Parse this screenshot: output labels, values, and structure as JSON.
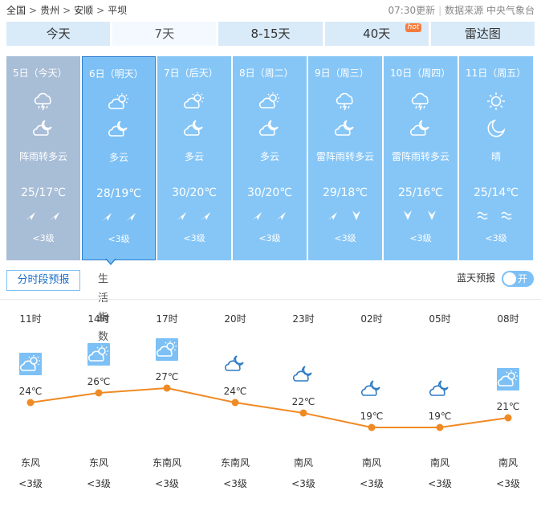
{
  "breadcrumb": {
    "items": [
      "全国",
      "贵州",
      "安顺",
      "平坝"
    ],
    "separator": ">"
  },
  "meta": {
    "update_time": "07:30更新",
    "source": "数据来源 中央气象台"
  },
  "tabs": [
    {
      "label": "今天",
      "active": false
    },
    {
      "label": "7天",
      "active": true
    },
    {
      "label": "8-15天",
      "active": false
    },
    {
      "label": "40天",
      "active": false,
      "badge": "hot"
    },
    {
      "label": "雷达图",
      "active": false
    }
  ],
  "days": [
    {
      "date": "5日（今天）",
      "day_icon": "thunder-rain-icon",
      "night_icon": "moon-cloud-icon",
      "desc": "阵雨转多云",
      "temp": "25/17℃",
      "wind_dirs": [
        "northeast",
        "northeast"
      ],
      "wind_level": "<3级",
      "state": "past"
    },
    {
      "date": "6日（明天）",
      "day_icon": "sun-cloud-icon",
      "night_icon": "moon-cloud-icon",
      "desc": "多云",
      "temp": "28/19℃",
      "wind_dirs": [
        "northeast",
        "northeast"
      ],
      "wind_level": "<3级",
      "state": "selected"
    },
    {
      "date": "7日（后天）",
      "day_icon": "sun-cloud-icon",
      "night_icon": "moon-cloud-icon",
      "desc": "多云",
      "temp": "30/20℃",
      "wind_dirs": [
        "northeast",
        "northeast"
      ],
      "wind_level": "<3级",
      "state": "normal"
    },
    {
      "date": "8日（周二）",
      "day_icon": "sun-cloud-icon",
      "night_icon": "moon-cloud-icon",
      "desc": "多云",
      "temp": "30/20℃",
      "wind_dirs": [
        "northeast",
        "northeast"
      ],
      "wind_level": "<3级",
      "state": "normal"
    },
    {
      "date": "9日（周三）",
      "day_icon": "thunder-rain-icon",
      "night_icon": "moon-cloud-icon",
      "desc": "雷阵雨转多云",
      "temp": "29/18℃",
      "wind_dirs": [
        "northeast",
        "south"
      ],
      "wind_level": "<3级",
      "state": "normal"
    },
    {
      "date": "10日（周四）",
      "day_icon": "thunder-rain-icon",
      "night_icon": "moon-cloud-icon",
      "desc": "雷阵雨转多云",
      "temp": "25/16℃",
      "wind_dirs": [
        "south",
        "south"
      ],
      "wind_level": "<3级",
      "state": "normal"
    },
    {
      "date": "11日（周五）",
      "day_icon": "sun-icon",
      "night_icon": "moon-icon",
      "desc": "晴",
      "temp": "25/14℃",
      "wind_dirs": [
        "variable",
        "variable"
      ],
      "wind_level": "<3级",
      "state": "normal"
    }
  ],
  "subtabs": [
    {
      "label": "分时段预报",
      "active": true
    },
    {
      "label": "生活指数",
      "active": false
    }
  ],
  "bluesky": {
    "label": "蓝天预报",
    "toggle": "开"
  },
  "hourly": [
    {
      "time": "11时",
      "icon": "sun-cloud-icon",
      "icon_box": true,
      "temp": "24℃",
      "temp_value": 24,
      "wind": "东风",
      "level": "<3级"
    },
    {
      "time": "14时",
      "icon": "sun-cloud-icon",
      "icon_box": true,
      "temp": "26℃",
      "temp_value": 26,
      "wind": "东风",
      "level": "<3级"
    },
    {
      "time": "17时",
      "icon": "sun-cloud-icon",
      "icon_box": true,
      "temp": "27℃",
      "temp_value": 27,
      "wind": "东南风",
      "level": "<3级"
    },
    {
      "time": "20时",
      "icon": "moon-cloud-icon",
      "icon_box": false,
      "temp": "24℃",
      "temp_value": 24,
      "wind": "东南风",
      "level": "<3级"
    },
    {
      "time": "23时",
      "icon": "moon-cloud-icon",
      "icon_box": false,
      "temp": "22℃",
      "temp_value": 22,
      "wind": "南风",
      "level": "<3级"
    },
    {
      "time": "02时",
      "icon": "moon-cloud-icon",
      "icon_box": false,
      "temp": "19℃",
      "temp_value": 19,
      "wind": "南风",
      "level": "<3级"
    },
    {
      "time": "05时",
      "icon": "moon-cloud-icon",
      "icon_box": false,
      "temp": "19℃",
      "temp_value": 19,
      "wind": "南风",
      "level": "<3级"
    },
    {
      "time": "08时",
      "icon": "sun-cloud-icon",
      "icon_box": true,
      "temp": "21℃",
      "temp_value": 21,
      "wind": "南风",
      "level": "<3级"
    }
  ],
  "colors": {
    "line": "#f08a24",
    "panel": "#86c6f7",
    "panel_past": "#a8bdd6",
    "selected_border": "#2b7fd1",
    "tab_bg": "#d9eaf9"
  }
}
